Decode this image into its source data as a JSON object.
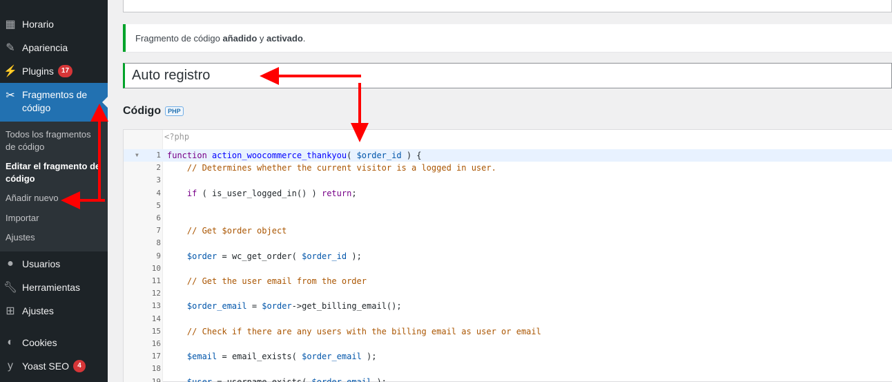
{
  "sidebar": {
    "items_top": [
      {
        "label": "Horario",
        "icon": "calendar-icon"
      },
      {
        "label": "Apariencia",
        "icon": "paintbrush-icon"
      },
      {
        "label": "Plugins",
        "icon": "plugin-icon",
        "badge": "17"
      }
    ],
    "active": {
      "label": "Fragmentos de código",
      "icon": "scissors-icon"
    },
    "submenu": [
      {
        "label": "Todos los fragmentos de código"
      },
      {
        "label": "Editar el fragmento de código",
        "current": true
      },
      {
        "label": "Añadir nuevo"
      },
      {
        "label": "Importar"
      },
      {
        "label": "Ajustes"
      }
    ],
    "items_bottom": [
      {
        "label": "Usuarios",
        "icon": "users-icon"
      },
      {
        "label": "Herramientas",
        "icon": "wrench-icon"
      },
      {
        "label": "Ajustes",
        "icon": "settings-icon"
      },
      {
        "label": "Cookies",
        "icon": "cookie-icon"
      },
      {
        "label": "Yoast SEO",
        "icon": "yoast-icon",
        "badge": "4"
      }
    ]
  },
  "notice": {
    "prefix": "Fragmento de código ",
    "bold1": "añadido",
    "middle": " y ",
    "bold2": "activado",
    "suffix": "."
  },
  "snippet": {
    "title": "Auto registro",
    "code_heading": "Código",
    "lang_badge": "PHP",
    "php_open_tag": "<?php"
  },
  "code_lines": [
    {
      "n": "1",
      "t": "function action_woocommerce_thankyou( $order_id ) {"
    },
    {
      "n": "2",
      "t": "    // Determines whether the current visitor is a logged in user."
    },
    {
      "n": "3",
      "t": ""
    },
    {
      "n": "4",
      "t": "    if ( is_user_logged_in() ) return;"
    },
    {
      "n": "5",
      "t": ""
    },
    {
      "n": "6",
      "t": ""
    },
    {
      "n": "7",
      "t": "    // Get $order object"
    },
    {
      "n": "8",
      "t": ""
    },
    {
      "n": "9",
      "t": "    $order = wc_get_order( $order_id );"
    },
    {
      "n": "10",
      "t": ""
    },
    {
      "n": "11",
      "t": "    // Get the user email from the order"
    },
    {
      "n": "12",
      "t": ""
    },
    {
      "n": "13",
      "t": "    $order_email = $order->get_billing_email();"
    },
    {
      "n": "14",
      "t": ""
    },
    {
      "n": "15",
      "t": "    // Check if there are any users with the billing email as user or email"
    },
    {
      "n": "16",
      "t": ""
    },
    {
      "n": "17",
      "t": "    $email = email_exists( $order_email );"
    },
    {
      "n": "18",
      "t": ""
    },
    {
      "n": "19",
      "t": "    $user = username_exists( $order_email );"
    }
  ],
  "colors": {
    "sidebar_bg": "#1d2327",
    "active_bg": "#2271b1",
    "badge": "#d63638",
    "success": "#00a32a",
    "arrow": "#ff0000"
  }
}
